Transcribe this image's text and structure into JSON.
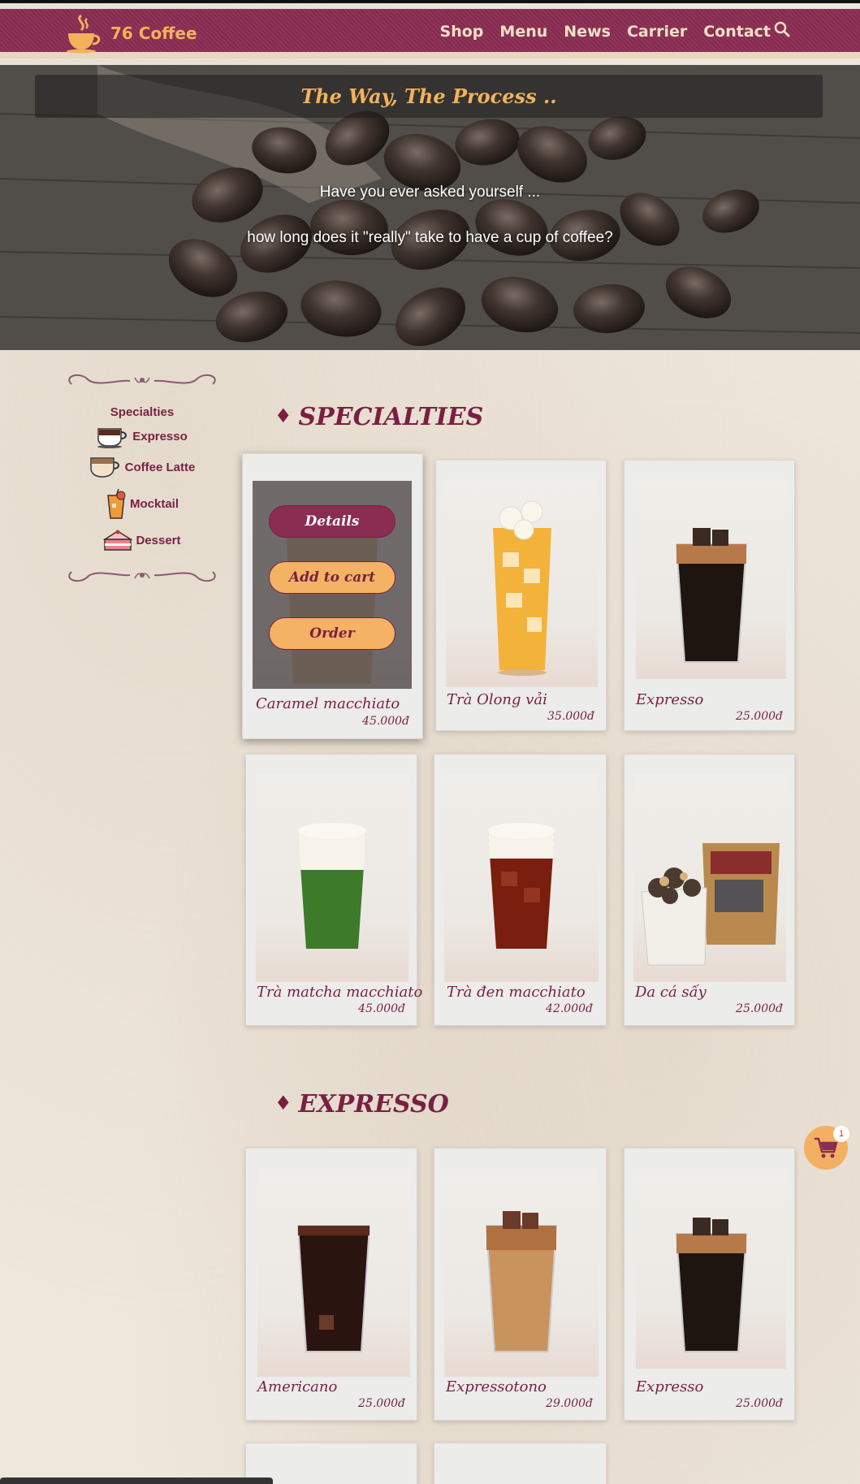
{
  "brand": {
    "name": "76 Coffee",
    "accent": "#f2b25b",
    "primary": "#8a2d52"
  },
  "nav": {
    "items": [
      "Shop",
      "Menu",
      "News",
      "Carrier",
      "Contact"
    ]
  },
  "hero": {
    "title": "The Way, The Process ..",
    "line1": "Have you ever asked yourself ...",
    "line2": "how long does it \"really\" take to have a cup of coffee?"
  },
  "sidebar": {
    "title": "Specialties",
    "items": [
      {
        "label": "Expresso",
        "icon": "espresso-cup-icon"
      },
      {
        "label": "Coffee Latte",
        "icon": "latte-cup-icon"
      },
      {
        "label": "Mocktail",
        "icon": "mocktail-glass-icon"
      },
      {
        "label": "Dessert",
        "icon": "cake-icon"
      }
    ]
  },
  "sections": [
    {
      "title": "SPECIALTIES",
      "products": [
        {
          "name": "Caramel macchiato",
          "price": "45.000đ"
        },
        {
          "name": "Trà Olong vải",
          "price": "35.000đ"
        },
        {
          "name": "Expresso",
          "price": "25.000đ"
        },
        {
          "name": "Trà matcha macchiato",
          "price": "45.000đ"
        },
        {
          "name": "Trà đen macchiato",
          "price": "42.000đ"
        },
        {
          "name": "Da cá sấy",
          "price": "25.000đ"
        }
      ]
    },
    {
      "title": "EXPRESSO",
      "products": [
        {
          "name": "Americano",
          "price": "25.000đ"
        },
        {
          "name": "Expressotono",
          "price": "29.000đ"
        },
        {
          "name": "Expresso",
          "price": "25.000đ"
        }
      ]
    }
  ],
  "overlay_buttons": {
    "details": "Details",
    "add_to_cart": "Add to cart",
    "order": "Order"
  },
  "cart": {
    "count": "1"
  }
}
